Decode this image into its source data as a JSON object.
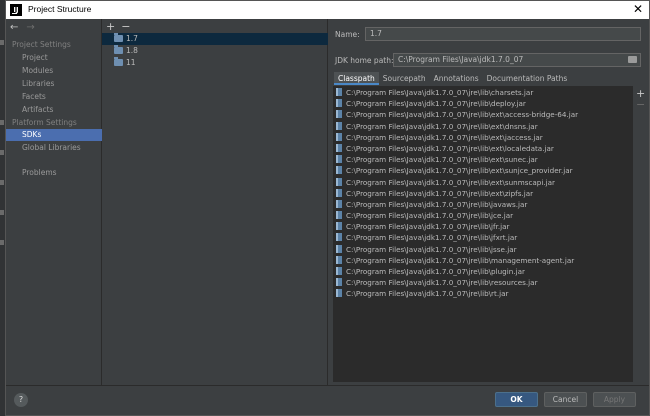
{
  "window": {
    "title": "Project Structure",
    "logo_text": "IJ",
    "close_glyph": "✕"
  },
  "nav": {
    "back_glyph": "←",
    "forward_glyph": "→",
    "project_settings_label": "Project Settings",
    "platform_settings_label": "Platform Settings",
    "items": [
      {
        "label": "Project"
      },
      {
        "label": "Modules"
      },
      {
        "label": "Libraries"
      },
      {
        "label": "Facets"
      },
      {
        "label": "Artifacts"
      },
      {
        "label": "SDKs"
      },
      {
        "label": "Global Libraries"
      },
      {
        "label": "Problems"
      }
    ],
    "selected": "SDKs"
  },
  "sdk_list": {
    "add_glyph": "+",
    "remove_glyph": "−",
    "items": [
      {
        "label": "1.7"
      },
      {
        "label": "1.8"
      },
      {
        "label": "11"
      }
    ],
    "selected": "1.7"
  },
  "detail": {
    "name_label": "Name:",
    "name_value": "1.7",
    "home_label": "JDK home path:",
    "home_value": "C:\\Program Files\\Java\\jdk1.7.0_07",
    "tabs": [
      {
        "label": "Classpath"
      },
      {
        "label": "Sourcepath"
      },
      {
        "label": "Annotations"
      },
      {
        "label": "Documentation Paths"
      }
    ],
    "active_tab": "Classpath",
    "add_path_glyph": "+",
    "remove_path_glyph": "−",
    "classpath": [
      "C:\\Program Files\\Java\\jdk1.7.0_07\\jre\\lib\\charsets.jar",
      "C:\\Program Files\\Java\\jdk1.7.0_07\\jre\\lib\\deploy.jar",
      "C:\\Program Files\\Java\\jdk1.7.0_07\\jre\\lib\\ext\\access-bridge-64.jar",
      "C:\\Program Files\\Java\\jdk1.7.0_07\\jre\\lib\\ext\\dnsns.jar",
      "C:\\Program Files\\Java\\jdk1.7.0_07\\jre\\lib\\ext\\jaccess.jar",
      "C:\\Program Files\\Java\\jdk1.7.0_07\\jre\\lib\\ext\\localedata.jar",
      "C:\\Program Files\\Java\\jdk1.7.0_07\\jre\\lib\\ext\\sunec.jar",
      "C:\\Program Files\\Java\\jdk1.7.0_07\\jre\\lib\\ext\\sunjce_provider.jar",
      "C:\\Program Files\\Java\\jdk1.7.0_07\\jre\\lib\\ext\\sunmscapi.jar",
      "C:\\Program Files\\Java\\jdk1.7.0_07\\jre\\lib\\ext\\zipfs.jar",
      "C:\\Program Files\\Java\\jdk1.7.0_07\\jre\\lib\\javaws.jar",
      "C:\\Program Files\\Java\\jdk1.7.0_07\\jre\\lib\\jce.jar",
      "C:\\Program Files\\Java\\jdk1.7.0_07\\jre\\lib\\jfr.jar",
      "C:\\Program Files\\Java\\jdk1.7.0_07\\jre\\lib\\jfxrt.jar",
      "C:\\Program Files\\Java\\jdk1.7.0_07\\jre\\lib\\jsse.jar",
      "C:\\Program Files\\Java\\jdk1.7.0_07\\jre\\lib\\management-agent.jar",
      "C:\\Program Files\\Java\\jdk1.7.0_07\\jre\\lib\\plugin.jar",
      "C:\\Program Files\\Java\\jdk1.7.0_07\\jre\\lib\\resources.jar",
      "C:\\Program Files\\Java\\jdk1.7.0_07\\jre\\lib\\rt.jar"
    ]
  },
  "footer": {
    "help_glyph": "?",
    "ok_label": "OK",
    "cancel_label": "Cancel",
    "apply_label": "Apply"
  },
  "colors": {
    "selection": "#4b6eaf",
    "primary_button": "#365880",
    "panel": "#3c3f41",
    "list_background": "#2b2b2b"
  }
}
